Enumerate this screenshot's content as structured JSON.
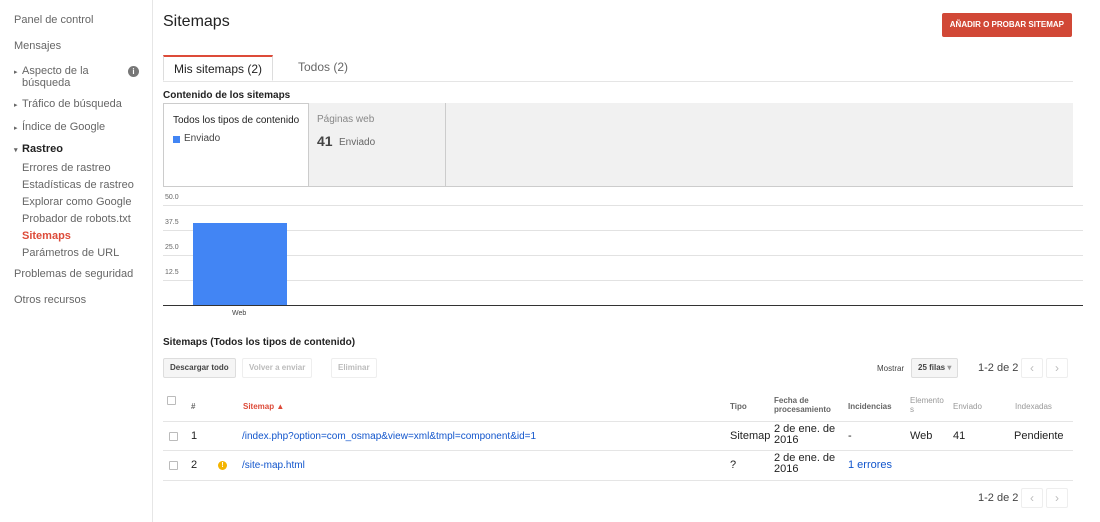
{
  "sidebar": {
    "items": [
      {
        "label": "Panel de control"
      },
      {
        "label": "Mensajes"
      },
      {
        "label": "Aspecto de la"
      },
      {
        "label": "búsqueda"
      },
      {
        "label": "Tráfico de búsqueda"
      },
      {
        "label": "Índice de Google"
      },
      {
        "label": "Rastreo"
      },
      {
        "label": "Errores de rastreo"
      },
      {
        "label": "Estadísticas de rastreo"
      },
      {
        "label": "Explorar como Google"
      },
      {
        "label": "Probador de robots.txt"
      },
      {
        "label": "Sitemaps"
      },
      {
        "label": "Parámetros de URL"
      },
      {
        "label": "Problemas de seguridad"
      },
      {
        "label": "Otros recursos"
      }
    ]
  },
  "header": {
    "title": "Sitemaps",
    "add_button": "AÑADIR O PROBAR SITEMAP"
  },
  "tabs": [
    {
      "label": "Mis sitemaps (2)"
    },
    {
      "label": "Todos (2)"
    }
  ],
  "content": {
    "title": "Contenido de los sitemaps",
    "all_types": {
      "label": "Todos los tipos de contenido",
      "legend": "Enviado"
    },
    "web": {
      "label": "Páginas web",
      "count": "41",
      "status": "Enviado"
    }
  },
  "chart_data": {
    "type": "bar",
    "categories": [
      "Web"
    ],
    "series": [
      {
        "name": "Enviado",
        "values": [
          41
        ]
      }
    ],
    "yticks": [
      "12.5",
      "25.0",
      "37.5",
      "50.0"
    ],
    "ylim": [
      0,
      50
    ],
    "colors": {
      "bar": "#4285f4"
    }
  },
  "table": {
    "title": "Sitemaps (Todos los tipos de contenido)",
    "toolbar": {
      "download": "Descargar todo",
      "resubmit": "Volver a enviar",
      "delete": "Eliminar",
      "show_label": "Mostrar",
      "rows_select": "25 filas",
      "pager": "1-2 de 2"
    },
    "headers": {
      "num": "#",
      "sitemap": "Sitemap ▲",
      "type": "Tipo",
      "date_1": "Fecha de",
      "date_2": "procesamiento",
      "issues": "Incidencias",
      "elements_1": "Elemento",
      "elements_2": "s",
      "submitted": "Enviado",
      "indexed": "Indexadas"
    },
    "rows": [
      {
        "num": "1",
        "sitemap": "/index.php?option=com_osmap&view=xml&tmpl=component&id=1",
        "type": "Sitemap",
        "date_1": "2 de ene. de",
        "date_2": "2016",
        "issues": "-",
        "elements": "Web",
        "submitted": "41",
        "indexed": "Pendiente"
      },
      {
        "num": "2",
        "sitemap": "/site-map.html",
        "type": "?",
        "date_1": "2 de ene. de",
        "date_2": "2016",
        "issues": "1 errores",
        "elements": "",
        "submitted": "",
        "indexed": ""
      }
    ],
    "footer_pager": "1-2 de 2"
  }
}
